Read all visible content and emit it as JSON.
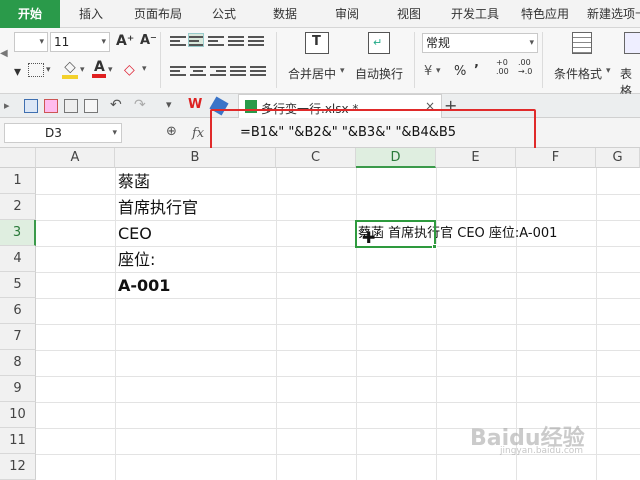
{
  "ribbon_tabs": [
    "开始",
    "插入",
    "页面布局",
    "公式",
    "数据",
    "审阅",
    "视图",
    "开发工具",
    "特色应用",
    "新建选项卡"
  ],
  "font_size": "11",
  "number_format": "常规",
  "labels": {
    "merge_center": "合并居中",
    "wrap_text": "自动换行",
    "conditional_format": "条件格式",
    "table_style": "表格"
  },
  "document_tab": {
    "title": "多行变一行.xlsx *",
    "close": "×",
    "add": "+"
  },
  "formula_bar": {
    "name_box": "D3",
    "fx": "fx",
    "formula": "=B1&\" \"&B2&\" \"&B3&\" \"&B4&B5"
  },
  "columns": [
    "A",
    "B",
    "C",
    "D",
    "E",
    "F",
    "G"
  ],
  "rows": [
    "1",
    "2",
    "3",
    "4",
    "5",
    "6",
    "7",
    "8",
    "9",
    "10",
    "11",
    "12"
  ],
  "cells": {
    "B1": "蔡菡",
    "B2": "首席执行官",
    "B3": "CEO",
    "B4": "座位:",
    "B5": "A-001",
    "D3": "蔡菡 首席执行官 CEO 座位:A-001"
  },
  "watermark": "Baidu经验",
  "watermark_url": "jingyan.baidu.com",
  "colors": {
    "accent": "#2a9a4a",
    "highlight_box": "#e02a2a"
  }
}
